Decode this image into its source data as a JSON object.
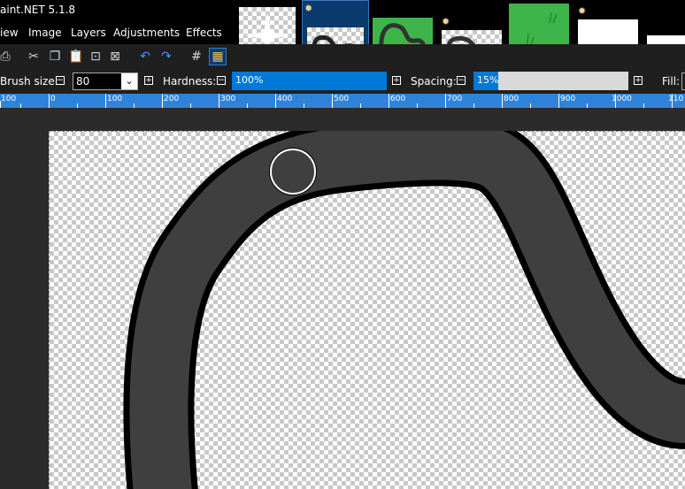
{
  "app": {
    "title": "aint.NET 5.1.8"
  },
  "menu": [
    "iew",
    "Image",
    "Layers",
    "Adjustments",
    "Effects"
  ],
  "image_tabs": [
    {
      "name": "star"
    },
    {
      "name": "track-outline",
      "dirty": true
    },
    {
      "name": "track-green"
    },
    {
      "name": "track-small",
      "dirty": true
    },
    {
      "name": "grass",
      "dirty": true
    },
    {
      "name": "blank-1"
    },
    {
      "name": "blank-2"
    }
  ],
  "toolbar_icons": [
    "print-icon",
    "cut-icon",
    "copy-icon",
    "paste-icon",
    "crop-icon",
    "deselect-icon",
    "undo-icon",
    "redo-icon",
    "grid-icon",
    "ruler-icon"
  ],
  "options": {
    "brush_size_label": "Brush size:",
    "brush_size_value": "80",
    "hardness_label": "Hardness:",
    "hardness_value": "100%",
    "spacing_label": "Spacing:",
    "spacing_value": "15%",
    "fill_label": "Fill:"
  },
  "ruler": [
    "100",
    "0",
    "100",
    "200",
    "300",
    "400",
    "500",
    "600",
    "700",
    "800",
    "900",
    "1000",
    "110"
  ],
  "colors": {
    "accent": "#0078d7",
    "track": "#3f3f3f",
    "outline": "#000000"
  }
}
